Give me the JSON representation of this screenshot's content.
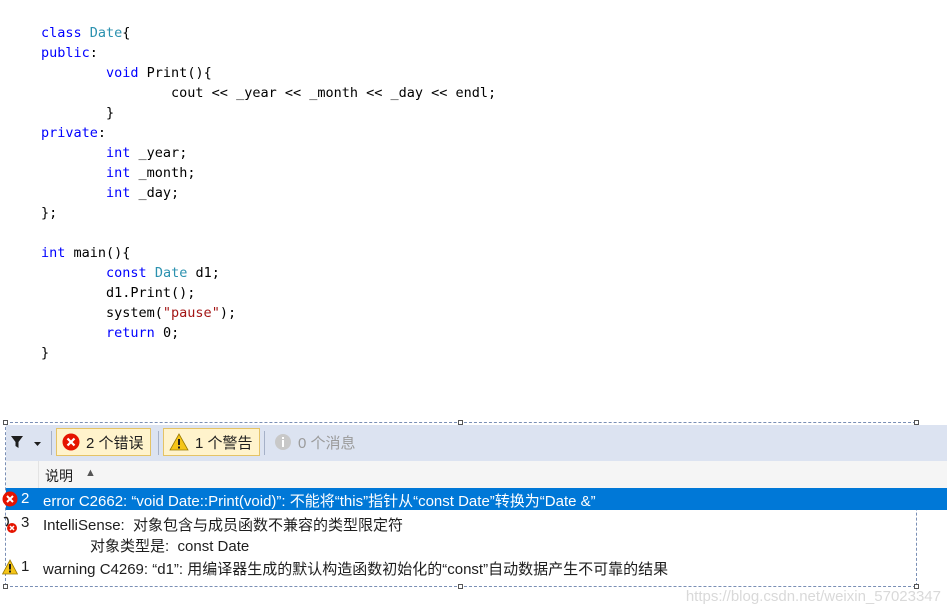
{
  "code": [
    [
      {
        "t": "class ",
        "c": "kw"
      },
      {
        "t": "Date",
        "c": "ty"
      },
      {
        "t": "{",
        "c": ""
      }
    ],
    [
      {
        "t": "public",
        "c": "kw"
      },
      {
        "t": ":",
        "c": ""
      }
    ],
    [
      {
        "t": "        ",
        "c": ""
      },
      {
        "t": "void",
        "c": "kw"
      },
      {
        "t": " Print(){",
        "c": ""
      }
    ],
    [
      {
        "t": "                cout << _year << _month << _day << endl;",
        "c": ""
      }
    ],
    [
      {
        "t": "        }",
        "c": ""
      }
    ],
    [
      {
        "t": "private",
        "c": "kw"
      },
      {
        "t": ":",
        "c": ""
      }
    ],
    [
      {
        "t": "        ",
        "c": ""
      },
      {
        "t": "int",
        "c": "kw"
      },
      {
        "t": " _year;",
        "c": ""
      }
    ],
    [
      {
        "t": "        ",
        "c": ""
      },
      {
        "t": "int",
        "c": "kw"
      },
      {
        "t": " _month;",
        "c": ""
      }
    ],
    [
      {
        "t": "        ",
        "c": ""
      },
      {
        "t": "int",
        "c": "kw"
      },
      {
        "t": " _day;",
        "c": ""
      }
    ],
    [
      {
        "t": "};",
        "c": ""
      }
    ],
    [
      {
        "t": "",
        "c": ""
      }
    ],
    [
      {
        "t": "int",
        "c": "kw"
      },
      {
        "t": " main(){",
        "c": ""
      }
    ],
    [
      {
        "t": "        ",
        "c": ""
      },
      {
        "t": "const",
        "c": "kw"
      },
      {
        "t": " ",
        "c": ""
      },
      {
        "t": "Date",
        "c": "ty"
      },
      {
        "t": " d1;",
        "c": ""
      }
    ],
    [
      {
        "t": "        d1.Print();",
        "c": ""
      }
    ],
    [
      {
        "t": "        system(",
        "c": ""
      },
      {
        "t": "\"pause\"",
        "c": "str"
      },
      {
        "t": ");",
        "c": ""
      }
    ],
    [
      {
        "t": "        ",
        "c": ""
      },
      {
        "t": "return",
        "c": "kw"
      },
      {
        "t": " 0;",
        "c": ""
      }
    ],
    [
      {
        "t": "}",
        "c": ""
      }
    ]
  ],
  "toolbar": {
    "errors_label": "2 个错误",
    "warnings_label": "1 个警告",
    "messages_label": "0 个消息"
  },
  "header": {
    "description_label": "说明",
    "sort_icon": "▲"
  },
  "rows": [
    {
      "num": "2",
      "text": "error C2662: “void Date::Print(void)”: 不能将“this”指针从“const Date”转换为“Date &”",
      "severity": "error"
    },
    {
      "num": "3",
      "text": "IntelliSense:  对象包含与成员函数不兼容的类型限定符",
      "sub": "对象类型是:  const Date",
      "severity": "error"
    },
    {
      "num": "1",
      "text": "warning C4269: “d1”: 用编译器生成的默认构造函数初始化的“const”自动数据产生不可靠的结果",
      "severity": "warning"
    }
  ],
  "watermark": "https://blog.csdn.net/weixin_57023347",
  "colors": {
    "keyword": "#0000ff",
    "type": "#2b91af",
    "string": "#a31515",
    "selected_row": "#0078d7",
    "toolbar_bg": "#dce3f1",
    "error": "#e51400",
    "warning": "#f5c518"
  }
}
